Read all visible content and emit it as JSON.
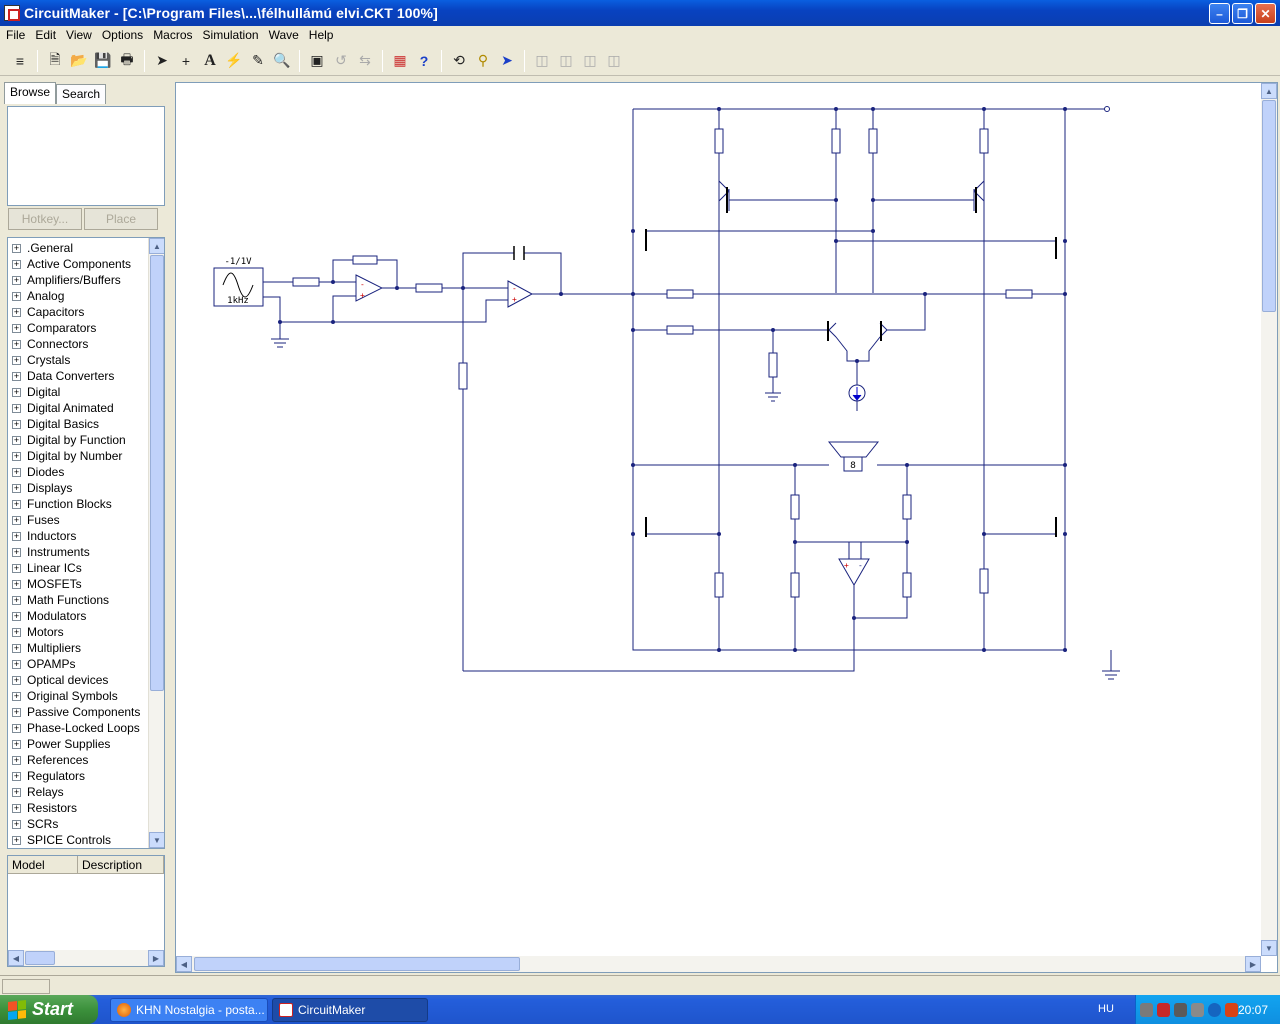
{
  "window": {
    "title": "CircuitMaker - [C:\\Program Files\\...\\félhullámú elvi.CKT 100%]"
  },
  "menu": [
    "File",
    "Edit",
    "View",
    "Options",
    "Macros",
    "Simulation",
    "Wave",
    "Help"
  ],
  "panel": {
    "tabs": [
      "Browse",
      "Search"
    ],
    "hotkey_label": "Hotkey...",
    "place_label": "Place",
    "categories": [
      ".General",
      "Active Components",
      "Amplifiers/Buffers",
      "Analog",
      "Capacitors",
      "Comparators",
      "Connectors",
      "Crystals",
      "Data Converters",
      "Digital",
      "Digital Animated",
      "Digital Basics",
      "Digital by Function",
      "Digital by Number",
      "Diodes",
      "Displays",
      "Function Blocks",
      "Fuses",
      "Inductors",
      "Instruments",
      "Linear ICs",
      "MOSFETs",
      "Math Functions",
      "Modulators",
      "Motors",
      "Multipliers",
      "OPAMPs",
      "Optical devices",
      "Original Symbols",
      "Passive Components",
      "Phase-Locked Loops",
      "Power Supplies",
      "References",
      "Regulators",
      "Relays",
      "Resistors",
      "SCRs",
      "SPICE Controls"
    ],
    "model_columns": [
      "Model",
      "Description"
    ]
  },
  "schematic": {
    "generator_amplitude": "-1/1V",
    "generator_freq": "1kHz",
    "speaker_label": "8"
  },
  "taskbar": {
    "start_label": "Start",
    "tasks": [
      "KHN Nostalgia - posta...",
      "CircuitMaker"
    ],
    "language": "HU",
    "clock": "20:07"
  }
}
